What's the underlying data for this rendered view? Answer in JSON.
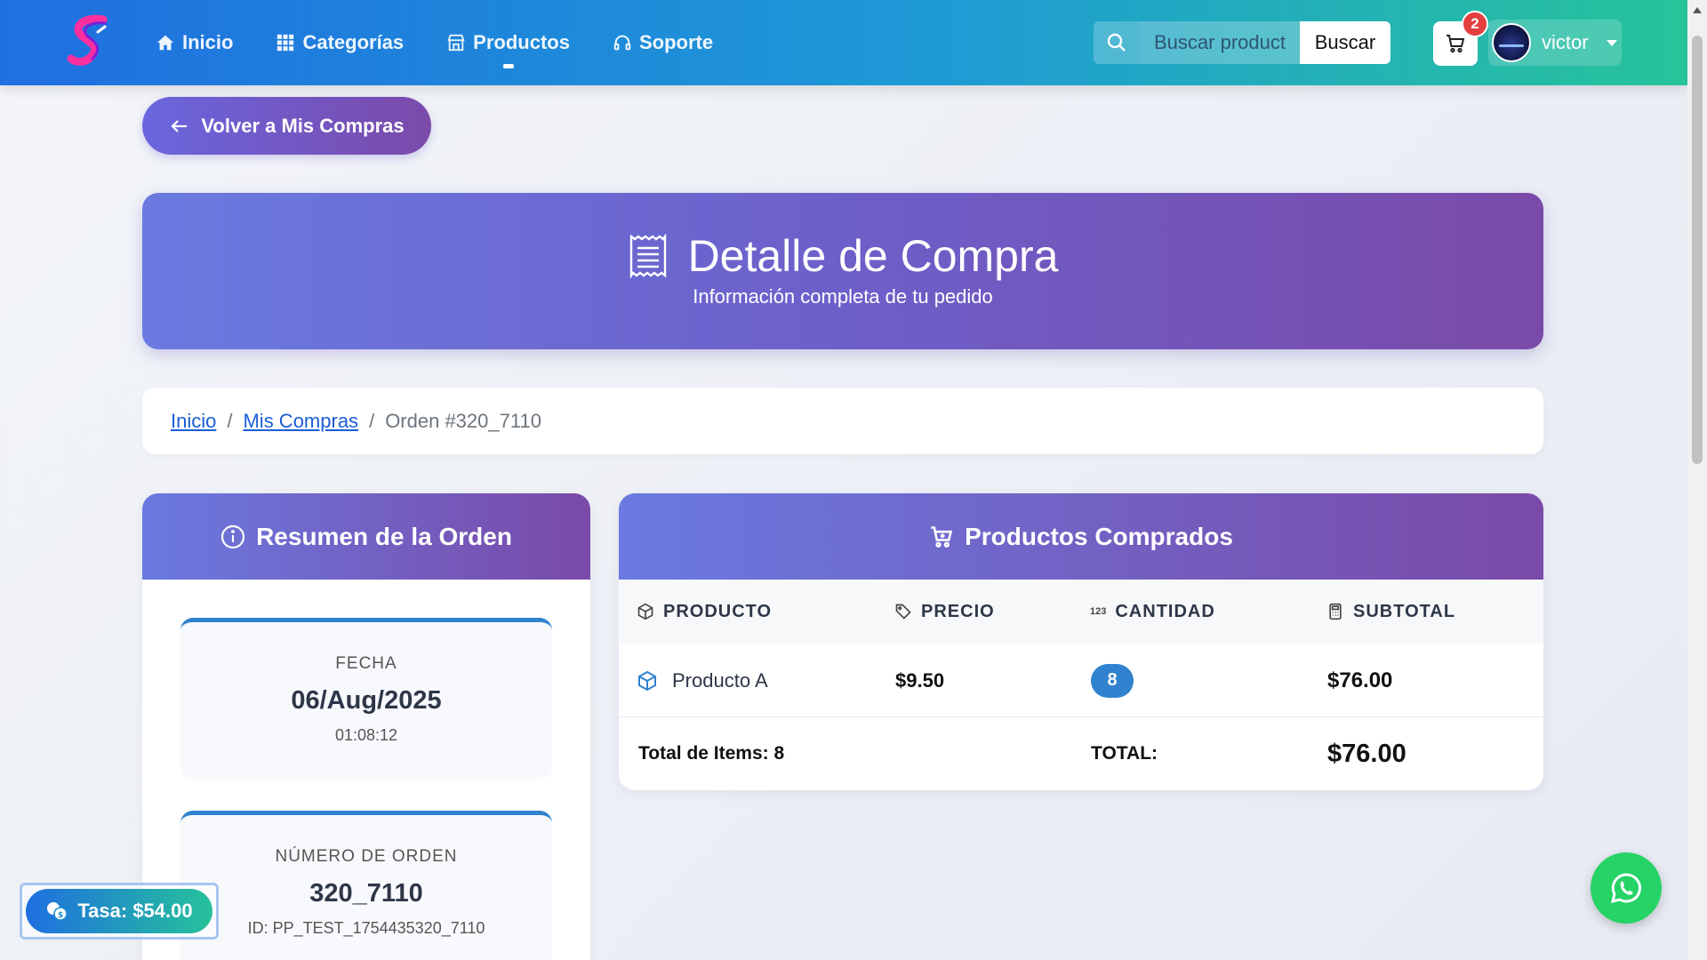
{
  "nav": {
    "links": [
      {
        "label": "Inicio",
        "icon": "home-icon"
      },
      {
        "label": "Categorías",
        "icon": "grid-icon"
      },
      {
        "label": "Productos",
        "icon": "store-icon"
      },
      {
        "label": "Soporte",
        "icon": "headset-icon"
      }
    ],
    "active": "Productos",
    "search_placeholder": "Buscar productos",
    "search_button": "Buscar",
    "cart_count": "2",
    "user_name": "victor"
  },
  "back_button": "Volver a Mis Compras",
  "hero": {
    "title": "Detalle de Compra",
    "subtitle": "Información completa de tu pedido"
  },
  "breadcrumb": {
    "home": "Inicio",
    "purchases": "Mis Compras",
    "current": "Orden #320_7110"
  },
  "summary": {
    "title": "Resumen de la Orden",
    "date_label": "FECHA",
    "date_value": "06/Aug/2025",
    "time_value": "01:08:12",
    "order_label": "NÚMERO DE ORDEN",
    "order_value": "320_7110",
    "order_id": "ID: PP_TEST_1754435320_7110"
  },
  "products": {
    "title": "Productos Comprados",
    "columns": [
      "PRODUCTO",
      "PRECIO",
      "CANTIDAD",
      "SUBTOTAL"
    ],
    "quantity_glyph": "123",
    "rows": [
      {
        "product": "Producto A",
        "price": "$9.50",
        "quantity": "8",
        "subtotal": "$76.00"
      }
    ],
    "total_items": "Total de Items: 8",
    "total_label": "TOTAL:",
    "total_value": "$76.00"
  },
  "tasa": "Tasa: $54.00",
  "colors": {
    "navbar_start": "#1f6fe0",
    "navbar_end": "#27c49a",
    "accent_purple": "#6d5fc9",
    "badge_blue": "#3182ce",
    "cart_badge": "#e53e3e",
    "whatsapp": "#25d366"
  }
}
